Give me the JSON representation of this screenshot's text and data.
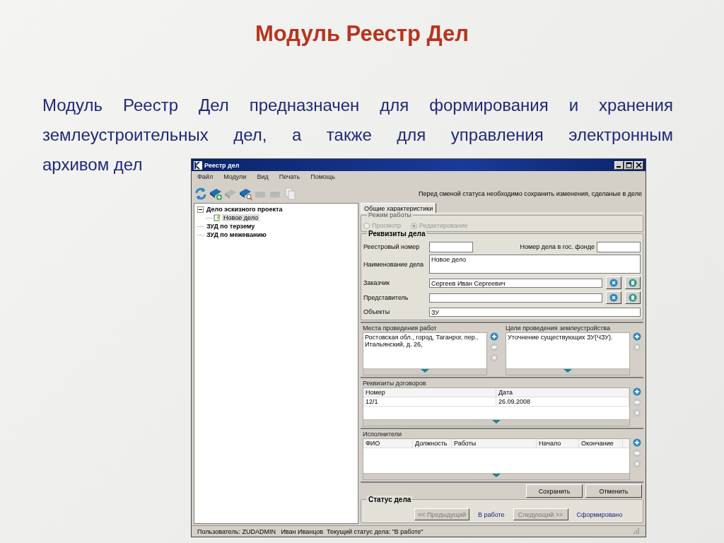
{
  "slide": {
    "title": "Модуль Реестр Дел",
    "paragraph": [
      "Модуль Реестр Дел предназначен для формирования и хранения землеустроительных дел, а также для управления электронным",
      "архивом дел"
    ]
  },
  "window": {
    "title": "Реестр дел",
    "menu": [
      "Файл",
      "Модули",
      "Вид",
      "Печать",
      "Помощь"
    ],
    "toolbar": [
      {
        "kind": "refresh",
        "disabled": false
      },
      {
        "kind": "add",
        "disabled": false
      },
      {
        "kind": "book",
        "disabled": true
      },
      {
        "kind": "search",
        "disabled": false
      },
      {
        "kind": "box",
        "disabled": true
      },
      {
        "kind": "box",
        "disabled": true
      },
      {
        "kind": "copy",
        "disabled": true
      }
    ],
    "notice": "Перед сменой статуса необходимо сохранить изменения, сделаные в деле",
    "tree": [
      {
        "label": "Дело эскизного проекта",
        "selected": false,
        "expanded": true,
        "children": [
          {
            "label": "Новое дело",
            "selected": true
          }
        ]
      },
      {
        "label": "ЗУД по терзему",
        "selected": false
      },
      {
        "label": "ЗУД по межеванию",
        "selected": false
      }
    ],
    "tabs": [
      {
        "label": "Общие характеристики",
        "selected": true
      }
    ],
    "mode": {
      "label": "Режим работы",
      "options": [
        {
          "label": "Просмотр",
          "selected": false,
          "disabled": true
        },
        {
          "label": "Редактирование",
          "selected": true,
          "disabled": true
        }
      ]
    },
    "requisites": {
      "label": "Реквизиты дела",
      "fields": [
        {
          "kind": "pair",
          "label": "Реестровый номер",
          "extra_label": "Номер дела в гос. фонде"
        },
        {
          "kind": "multiline",
          "label": "Наименование дела",
          "value": "Новое дело"
        },
        {
          "kind": "buttons",
          "label": "Заказчик",
          "value": "Сергеев Иван Сергеевич"
        },
        {
          "kind": "buttons",
          "label": "Представитель"
        },
        {
          "kind": "text",
          "label": "Объекты",
          "value": "ЗУ"
        }
      ]
    },
    "places": {
      "label": "Места проведения работ",
      "items": [
        "Ростовская обл., город, Таганрог, пер.. Итальянский, д. 26,"
      ],
      "actions": [
        {
          "kind": "add",
          "disabled": false
        },
        {
          "kind": "view",
          "disabled": true
        },
        {
          "kind": "remove",
          "disabled": true
        }
      ]
    },
    "goals": {
      "label": "Цели проведения землеустройства",
      "items": [
        "Уточнение существующих ЗУ(ЧЗУ)."
      ],
      "actions": [
        {
          "kind": "add",
          "disabled": false
        },
        {
          "kind": "remove",
          "disabled": true
        }
      ]
    },
    "contracts": {
      "label": "Реквизиты договоров",
      "columns": [
        "Номер",
        "Дата"
      ],
      "rows": [
        [
          "12/1",
          "26.09.2008"
        ]
      ],
      "actions": [
        {
          "kind": "add",
          "disabled": false
        },
        {
          "kind": "view",
          "disabled": true
        },
        {
          "kind": "remove",
          "disabled": true
        }
      ]
    },
    "executors": {
      "label": "Исполнители",
      "columns": [
        "ФИО",
        "Должность",
        "Работы",
        "Начало",
        "Окончание"
      ],
      "actions": [
        {
          "kind": "add",
          "disabled": false
        },
        {
          "kind": "view",
          "disabled": true
        },
        {
          "kind": "remove",
          "disabled": true
        }
      ]
    },
    "buttons": [
      "Сохранить",
      "Отменить"
    ],
    "status": {
      "label": "Статус дела",
      "steps": [
        {
          "kind": "button",
          "label": "<< Предыдущий",
          "disabled": true
        },
        {
          "kind": "link",
          "label": "В работе",
          "disabled": false
        },
        {
          "kind": "button",
          "label": "Следующий >>",
          "disabled": true
        },
        {
          "kind": "link",
          "label": "Сформировано",
          "disabled": false
        }
      ]
    },
    "status_bar": "Пользователь: ZUDADMIN   Иван Иванцов  Текущий статус дела: \"В работе\""
  }
}
